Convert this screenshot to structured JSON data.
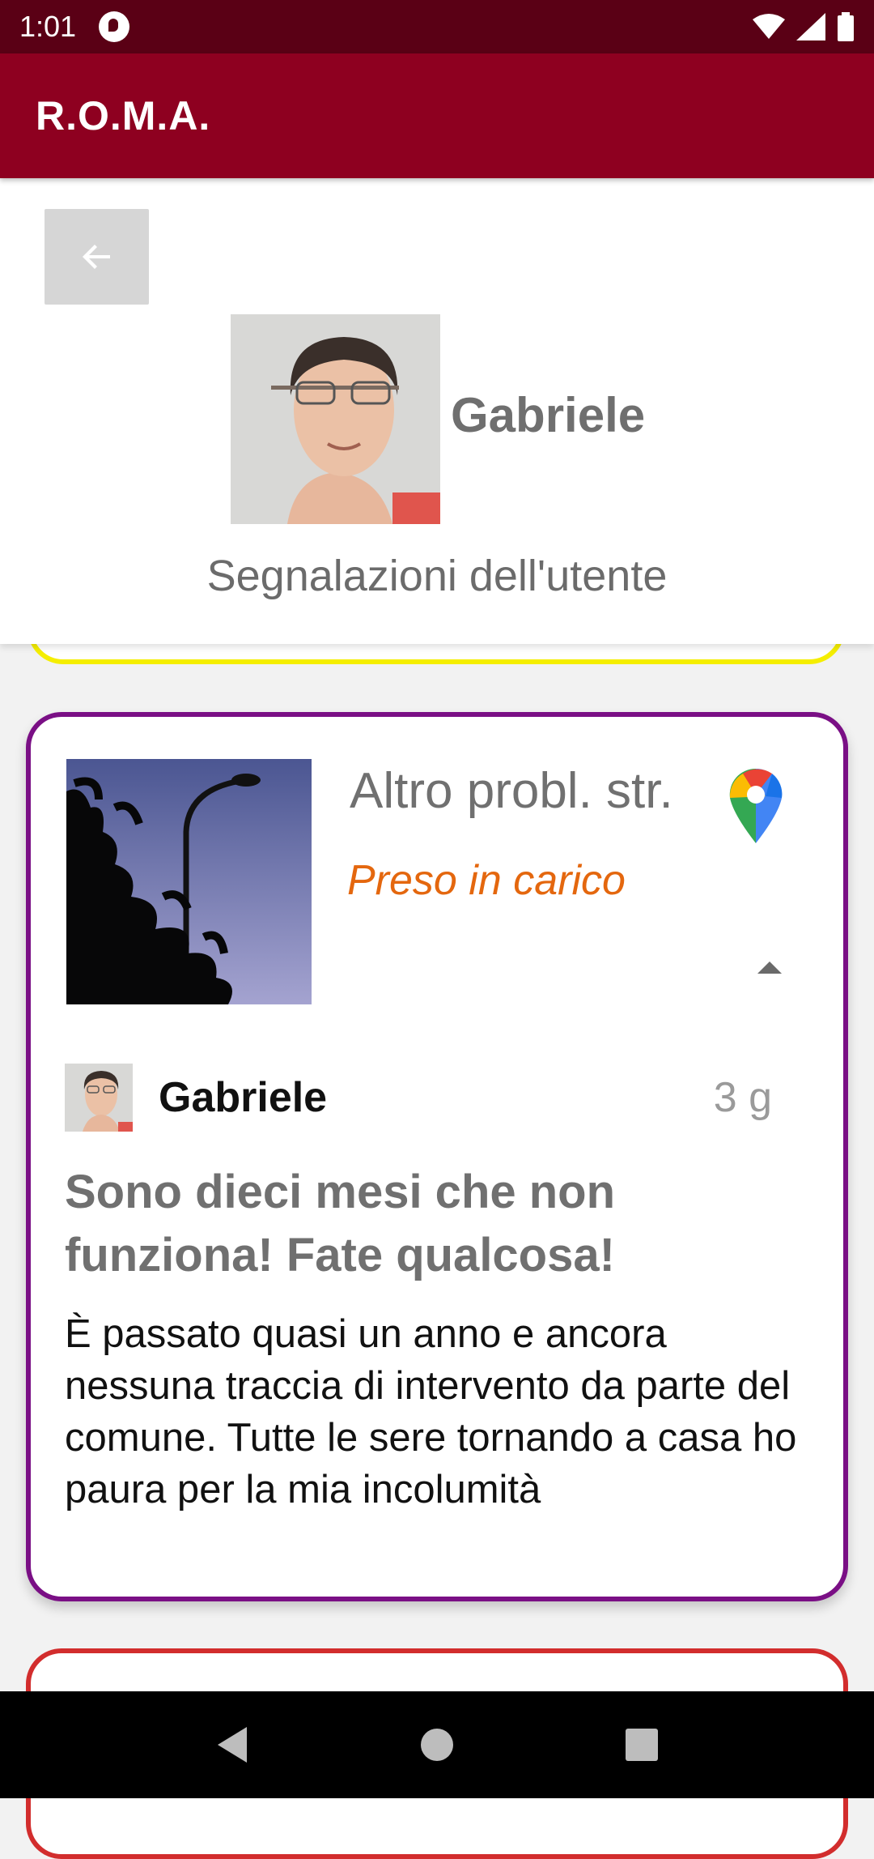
{
  "status_bar": {
    "time": "1:01"
  },
  "app_bar": {
    "title": "R.O.M.A."
  },
  "profile": {
    "name": "Gabriele",
    "section_title": "Segnalazioni dell'utente"
  },
  "report": {
    "category": "Altro probl. str.",
    "status": "Preso in carico",
    "author": "Gabriele",
    "age": "3 g",
    "title": "Sono dieci mesi che non funziona! Fate qualcosa!",
    "body": "È passato quasi un anno e ancora nessuna traccia di intervento da parte del comune. Tutte le sere tornando a casa ho paura per la mia incolumità"
  },
  "colors": {
    "app_bar": "#8e0020",
    "status_bar": "#5a0015",
    "card_border_previous": "#f5ee00",
    "card_border_current": "#7a0f85",
    "card_border_next": "#d22d2d",
    "status_text": "#e4670e"
  },
  "icons": {
    "back": "arrow-left-icon",
    "maps": "google-maps-pin-icon",
    "collapse": "triangle-up-icon",
    "nav_back": "triangle-left-icon",
    "nav_home": "circle-icon",
    "nav_recents": "square-icon"
  }
}
